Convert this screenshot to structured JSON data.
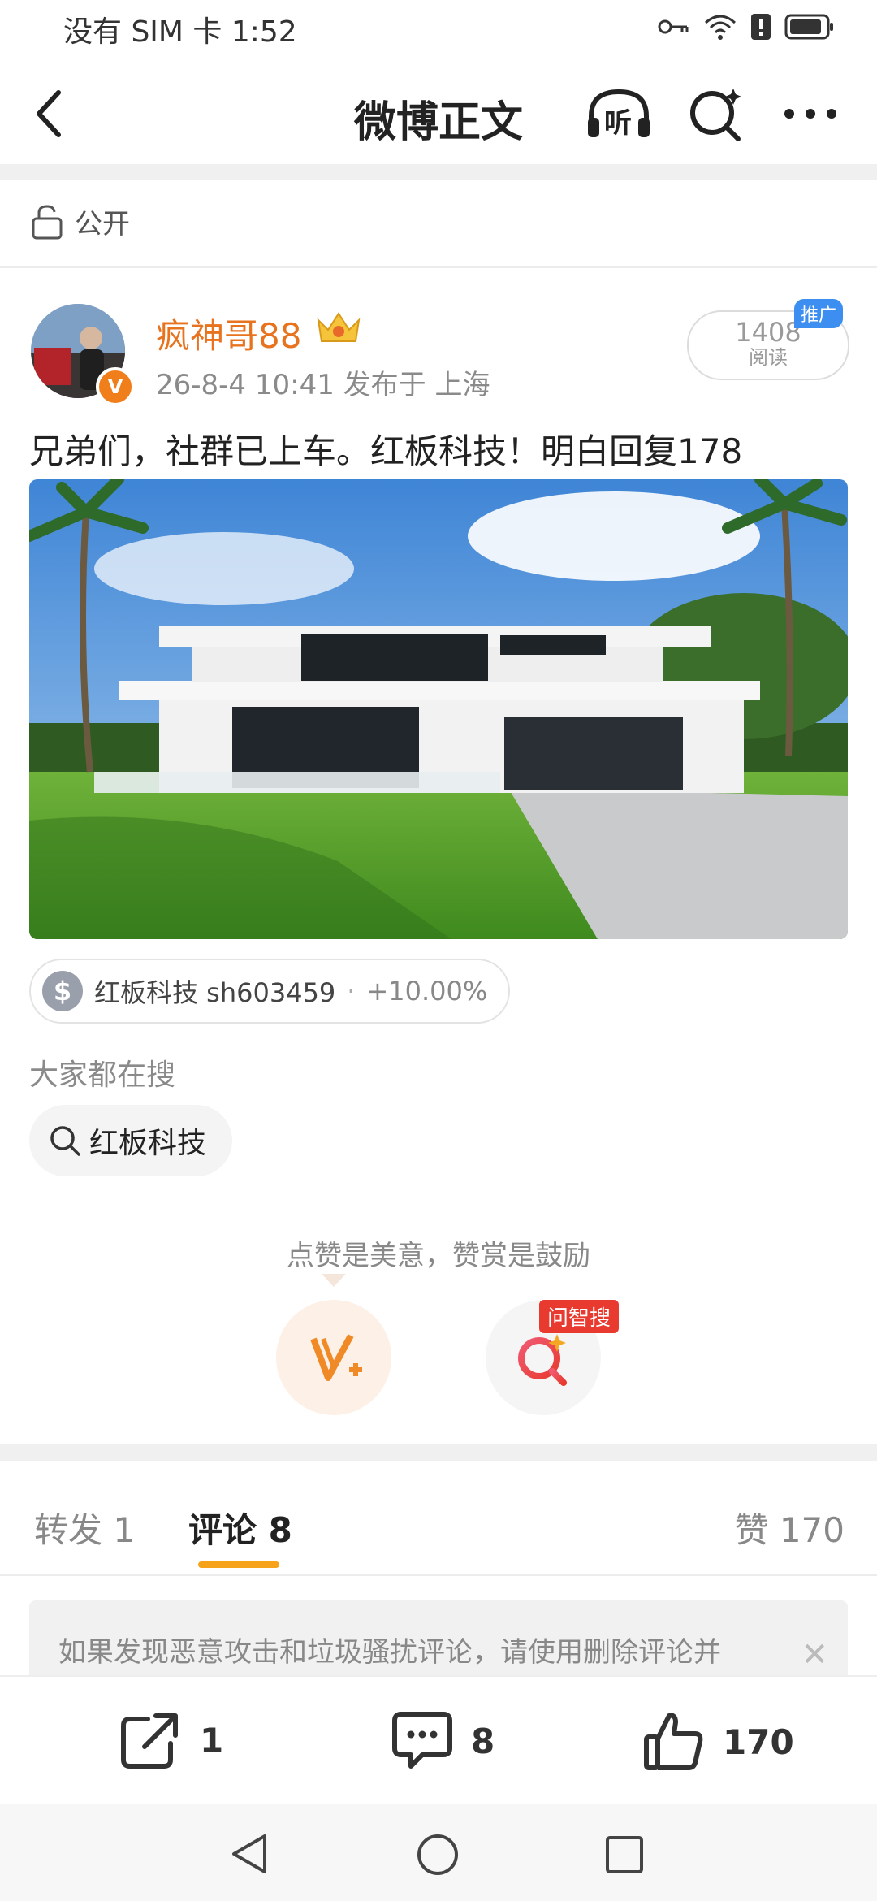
{
  "status_bar": {
    "left_text": "没有 SIM 卡 1:52"
  },
  "header": {
    "title": "微博正文",
    "listen_label": "听"
  },
  "visibility": {
    "label": "公开"
  },
  "post": {
    "author_name": "疯神哥88",
    "verified_mark": "V",
    "meta": "26-8-4 10:41   发布于 上海",
    "read_count": "1408",
    "read_label": "阅读",
    "promo_tag": "推广",
    "text": "兄弟们，社群已上车。红板科技！明白回复178",
    "image_description": ""
  },
  "stock": {
    "symbol_icon": "$",
    "name": "红板科技 sh603459",
    "dot": "·",
    "change": "+10.00%"
  },
  "trending": {
    "heading": "大家都在搜",
    "query": "红板科技"
  },
  "reward": {
    "hint": "点赞是美意，赞赏是鼓励",
    "ai_tag": "问智搜"
  },
  "tabs": {
    "repost": "转发 1",
    "comment": "评论 8",
    "like": "赞 170"
  },
  "notice": {
    "text": "如果发现恶意攻击和垃圾骚扰评论，请使用删除评论并"
  },
  "actions": {
    "repost_count": "1",
    "comment_count": "8",
    "like_count": "170"
  },
  "colors": {
    "accent": "#e8731f",
    "tab_underline": "#f7a21b",
    "promo_blue": "#3c8ef0",
    "ai_red": "#e83a2f"
  }
}
